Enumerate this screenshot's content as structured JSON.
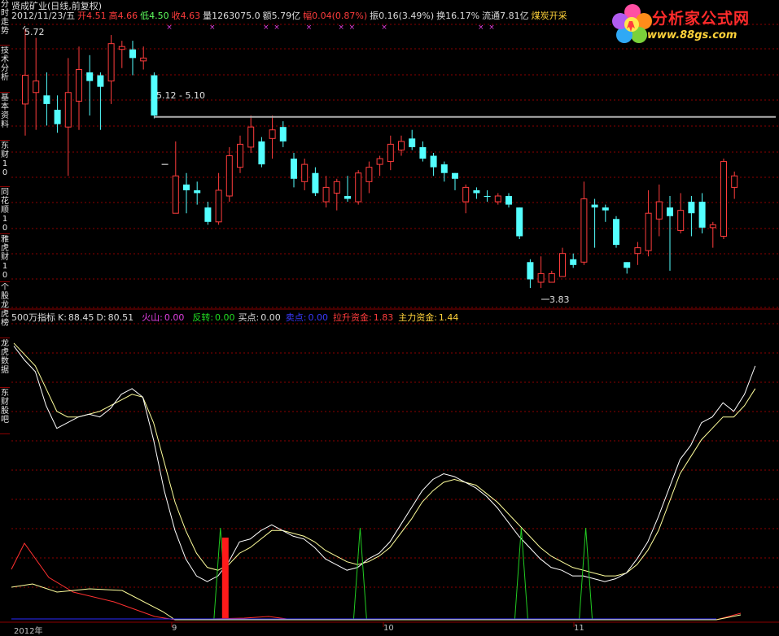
{
  "sidebar": {
    "tabs": [
      {
        "label": "分时走势"
      },
      {
        "label": "技术分析"
      },
      {
        "label": "基本资料"
      },
      {
        "label": "东财10"
      },
      {
        "label": "同花顺10"
      },
      {
        "label": "雅虎财10"
      },
      {
        "label": "个股龙虎榜"
      },
      {
        "label": "龙虎数据"
      },
      {
        "label": "东财股吧"
      }
    ]
  },
  "header": {
    "stock_title": "贤成矿业(日线,前复权)",
    "date": "2012/11/23/五",
    "open_label": "开",
    "open": "4.51",
    "high_label": "高",
    "high": "4.66",
    "low_label": "低",
    "low": "4.50",
    "close_label": "收",
    "close": "4.63",
    "volume_label": "量",
    "volume": "1263075.0",
    "amount_label": "额",
    "amount": "5.79亿",
    "change_label": "幅",
    "change": "0.04(0.87%)",
    "amplitude_label": "振",
    "amplitude": "0.16(3.49%)",
    "turnover_label": "换",
    "turnover": "16.17%",
    "float_label": "流通",
    "float": "7.81亿",
    "sector": "煤炭开采"
  },
  "logo": {
    "title": "分析家公式网",
    "url": "www.88gs.com"
  },
  "price_panel": {
    "high_mark": "5.72",
    "range_mark": "5.12 - 5.10",
    "low_mark": "3.83"
  },
  "indicator": {
    "name": "500万指标",
    "k_label": "K:",
    "k": "88.45",
    "d_label": "D:",
    "d": "80.51",
    "volcano_label": "火山:",
    "volcano": "0.00",
    "reversal_label": "反转:",
    "reversal": "0.00",
    "buy_label": "买点:",
    "buy": "0.00",
    "sell_label": "卖点:",
    "sell": "0.00",
    "pull_label": "拉升资金:",
    "pull": "1.83",
    "main_label": "主力资金:",
    "main": "1.44"
  },
  "x_axis": {
    "labels": [
      "2012年",
      "9",
      "10",
      "11"
    ]
  },
  "colors": {
    "up": "#ff3c3c",
    "down": "#54ffff",
    "grid": "#8b0000",
    "k_line": "#ffffff",
    "d_line": "#ffff9c",
    "signal": "#22cc22",
    "bar": "#ff1a1a"
  },
  "chart_data": {
    "type": "candlestick",
    "candles": [
      {
        "o": 5.2,
        "c": 5.4,
        "h": 5.72,
        "l": 4.98,
        "dir": "up"
      },
      {
        "o": 5.28,
        "c": 5.36,
        "h": 5.66,
        "l": 5.02,
        "dir": "up"
      },
      {
        "o": 5.26,
        "c": 5.2,
        "h": 5.42,
        "l": 5.05,
        "dir": "down"
      },
      {
        "o": 5.16,
        "c": 5.06,
        "h": 5.26,
        "l": 5.0,
        "dir": "down"
      },
      {
        "o": 5.04,
        "c": 5.28,
        "h": 5.52,
        "l": 4.7,
        "dir": "up"
      },
      {
        "o": 5.22,
        "c": 5.44,
        "h": 5.6,
        "l": 5.02,
        "dir": "up"
      },
      {
        "o": 5.42,
        "c": 5.36,
        "h": 5.54,
        "l": 5.12,
        "dir": "down"
      },
      {
        "o": 5.4,
        "c": 5.32,
        "h": 5.42,
        "l": 5.02,
        "dir": "down"
      },
      {
        "o": 5.36,
        "c": 5.62,
        "h": 5.68,
        "l": 5.2,
        "dir": "up"
      },
      {
        "o": 5.58,
        "c": 5.6,
        "h": 5.64,
        "l": 5.45,
        "dir": "up"
      },
      {
        "o": 5.58,
        "c": 5.52,
        "h": 5.64,
        "l": 5.4,
        "dir": "down"
      },
      {
        "o": 5.5,
        "c": 5.52,
        "h": 5.6,
        "l": 5.44,
        "dir": "up"
      },
      {
        "o": 5.4,
        "c": 5.12,
        "h": 5.42,
        "l": 5.1,
        "dir": "down"
      },
      {
        "o": 4.78,
        "c": 4.78,
        "h": 4.78,
        "l": 4.78,
        "dir": "flat"
      },
      {
        "o": 4.44,
        "c": 4.7,
        "h": 4.94,
        "l": 4.44,
        "dir": "up"
      },
      {
        "o": 4.64,
        "c": 4.6,
        "h": 4.72,
        "l": 4.44,
        "dir": "down"
      },
      {
        "o": 4.6,
        "c": 4.58,
        "h": 4.66,
        "l": 4.5,
        "dir": "down"
      },
      {
        "o": 4.48,
        "c": 4.38,
        "h": 4.52,
        "l": 4.36,
        "dir": "down"
      },
      {
        "o": 4.38,
        "c": 4.6,
        "h": 4.72,
        "l": 4.36,
        "dir": "up"
      },
      {
        "o": 4.56,
        "c": 4.84,
        "h": 4.9,
        "l": 4.52,
        "dir": "up"
      },
      {
        "o": 4.76,
        "c": 4.92,
        "h": 4.98,
        "l": 4.72,
        "dir": "up"
      },
      {
        "o": 4.9,
        "c": 5.04,
        "h": 5.12,
        "l": 4.86,
        "dir": "up"
      },
      {
        "o": 4.94,
        "c": 4.78,
        "h": 4.97,
        "l": 4.76,
        "dir": "down"
      },
      {
        "o": 4.96,
        "c": 5.02,
        "h": 5.12,
        "l": 4.82,
        "dir": "up"
      },
      {
        "o": 5.04,
        "c": 4.94,
        "h": 5.08,
        "l": 4.9,
        "dir": "down"
      },
      {
        "o": 4.82,
        "c": 4.68,
        "h": 4.86,
        "l": 4.62,
        "dir": "down"
      },
      {
        "o": 4.66,
        "c": 4.78,
        "h": 4.82,
        "l": 4.6,
        "dir": "up"
      },
      {
        "o": 4.72,
        "c": 4.58,
        "h": 4.76,
        "l": 4.56,
        "dir": "down"
      },
      {
        "o": 4.52,
        "c": 4.62,
        "h": 4.7,
        "l": 4.48,
        "dir": "up"
      },
      {
        "o": 4.58,
        "c": 4.66,
        "h": 4.68,
        "l": 4.46,
        "dir": "up"
      },
      {
        "o": 4.56,
        "c": 4.54,
        "h": 4.7,
        "l": 4.52,
        "dir": "down"
      },
      {
        "o": 4.52,
        "c": 4.72,
        "h": 4.74,
        "l": 4.5,
        "dir": "up"
      },
      {
        "o": 4.66,
        "c": 4.76,
        "h": 4.8,
        "l": 4.58,
        "dir": "up"
      },
      {
        "o": 4.78,
        "c": 4.82,
        "h": 4.84,
        "l": 4.7,
        "dir": "up"
      },
      {
        "o": 4.8,
        "c": 4.92,
        "h": 4.98,
        "l": 4.74,
        "dir": "up"
      },
      {
        "o": 4.88,
        "c": 4.94,
        "h": 4.98,
        "l": 4.84,
        "dir": "up"
      },
      {
        "o": 4.96,
        "c": 4.9,
        "h": 5.02,
        "l": 4.88,
        "dir": "down"
      },
      {
        "o": 4.9,
        "c": 4.82,
        "h": 4.94,
        "l": 4.8,
        "dir": "down"
      },
      {
        "o": 4.84,
        "c": 4.76,
        "h": 4.86,
        "l": 4.7,
        "dir": "down"
      },
      {
        "o": 4.78,
        "c": 4.72,
        "h": 4.8,
        "l": 4.66,
        "dir": "down"
      },
      {
        "o": 4.72,
        "c": 4.68,
        "h": 4.72,
        "l": 4.6,
        "dir": "down"
      },
      {
        "o": 4.52,
        "c": 4.62,
        "h": 4.64,
        "l": 4.44,
        "dir": "up"
      },
      {
        "o": 4.6,
        "c": 4.58,
        "h": 4.62,
        "l": 4.54,
        "dir": "down"
      },
      {
        "o": 4.56,
        "c": 4.56,
        "h": 4.6,
        "l": 4.52,
        "dir": "down"
      },
      {
        "o": 4.52,
        "c": 4.56,
        "h": 4.58,
        "l": 4.5,
        "dir": "up"
      },
      {
        "o": 4.56,
        "c": 4.5,
        "h": 4.58,
        "l": 4.48,
        "dir": "down"
      },
      {
        "o": 4.48,
        "c": 4.28,
        "h": 4.48,
        "l": 4.26,
        "dir": "down"
      },
      {
        "o": 4.1,
        "c": 3.98,
        "h": 4.12,
        "l": 3.92,
        "dir": "down"
      },
      {
        "o": 3.96,
        "c": 4.02,
        "h": 4.14,
        "l": 3.92,
        "dir": "up"
      },
      {
        "o": 3.96,
        "c": 4.02,
        "h": 4.04,
        "l": 3.96,
        "dir": "up"
      },
      {
        "o": 4.0,
        "c": 4.16,
        "h": 4.2,
        "l": 4.0,
        "dir": "up"
      },
      {
        "o": 4.12,
        "c": 4.08,
        "h": 4.16,
        "l": 4.06,
        "dir": "down"
      },
      {
        "o": 4.1,
        "c": 4.54,
        "h": 4.66,
        "l": 4.08,
        "dir": "up"
      },
      {
        "o": 4.5,
        "c": 4.48,
        "h": 4.54,
        "l": 4.2,
        "dir": "down"
      },
      {
        "o": 4.48,
        "c": 4.46,
        "h": 4.5,
        "l": 4.38,
        "dir": "down"
      },
      {
        "o": 4.4,
        "c": 4.22,
        "h": 4.42,
        "l": 4.2,
        "dir": "down"
      },
      {
        "o": 4.1,
        "c": 4.06,
        "h": 4.1,
        "l": 4.02,
        "dir": "down"
      },
      {
        "o": 4.16,
        "c": 4.2,
        "h": 4.24,
        "l": 4.08,
        "dir": "up"
      },
      {
        "o": 4.18,
        "c": 4.44,
        "h": 4.6,
        "l": 4.14,
        "dir": "up"
      },
      {
        "o": 4.4,
        "c": 4.52,
        "h": 4.64,
        "l": 4.28,
        "dir": "up"
      },
      {
        "o": 4.48,
        "c": 4.42,
        "h": 4.56,
        "l": 4.04,
        "dir": "down"
      },
      {
        "o": 4.32,
        "c": 4.46,
        "h": 4.58,
        "l": 4.3,
        "dir": "up"
      },
      {
        "o": 4.52,
        "c": 4.44,
        "h": 4.56,
        "l": 4.28,
        "dir": "down"
      },
      {
        "o": 4.52,
        "c": 4.34,
        "h": 4.58,
        "l": 4.3,
        "dir": "down"
      },
      {
        "o": 4.34,
        "c": 4.36,
        "h": 4.38,
        "l": 4.2,
        "dir": "up"
      },
      {
        "o": 4.28,
        "c": 4.8,
        "h": 4.82,
        "l": 4.26,
        "dir": "up"
      },
      {
        "o": 4.62,
        "c": 4.7,
        "h": 4.73,
        "l": 4.54,
        "dir": "up"
      }
    ],
    "k_series": [
      95,
      90,
      86,
      74,
      66,
      68,
      70,
      71,
      70,
      73,
      78,
      80,
      77,
      62,
      44,
      30,
      20,
      14,
      12,
      14,
      19,
      26,
      27,
      30,
      32,
      30,
      28,
      27,
      24,
      20,
      18,
      16,
      17,
      20,
      22,
      26,
      32,
      38,
      44,
      48,
      50,
      49,
      47,
      45,
      42,
      38,
      33,
      28,
      24,
      20,
      17,
      16,
      14,
      14,
      13,
      12,
      13,
      15,
      20,
      26,
      35,
      45,
      55,
      60,
      68,
      70,
      75,
      72,
      78,
      88
    ],
    "d_series": [
      96,
      92,
      88,
      80,
      72,
      70,
      70,
      71,
      72,
      74,
      76,
      78,
      77,
      68,
      54,
      40,
      30,
      22,
      17,
      16,
      18,
      22,
      24,
      27,
      30,
      30,
      29,
      28,
      26,
      23,
      21,
      19,
      18,
      19,
      21,
      24,
      29,
      34,
      40,
      44,
      47,
      48,
      47,
      46,
      43,
      40,
      36,
      32,
      28,
      24,
      21,
      19,
      17,
      16,
      15,
      14,
      14,
      15,
      18,
      23,
      30,
      40,
      50,
      56,
      62,
      66,
      70,
      70,
      74,
      80
    ],
    "signals": [
      19,
      32,
      47,
      53
    ],
    "bar_index": 19,
    "buy_flags": [
      1,
      5,
      10,
      11,
      14,
      17,
      18,
      21,
      30,
      31,
      42,
      47,
      51,
      55
    ],
    "ylim": [
      3.83,
      5.72
    ]
  }
}
